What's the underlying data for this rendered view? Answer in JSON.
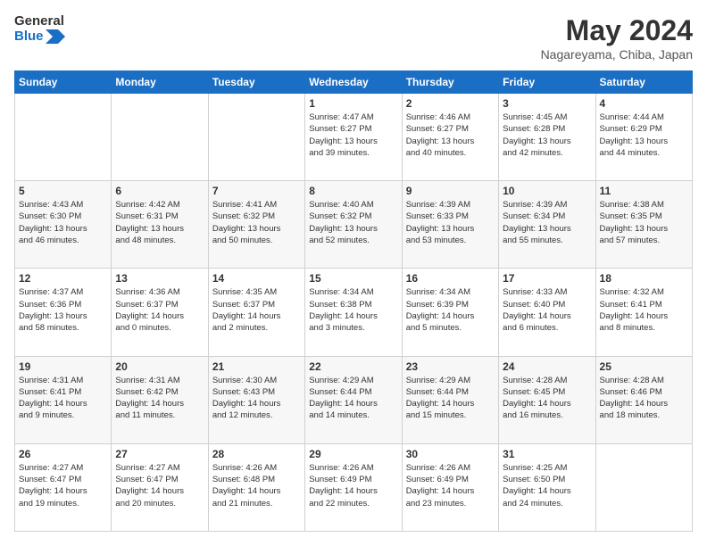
{
  "header": {
    "logo_line1": "General",
    "logo_line2": "Blue",
    "month_title": "May 2024",
    "location": "Nagareyama, Chiba, Japan"
  },
  "weekdays": [
    "Sunday",
    "Monday",
    "Tuesday",
    "Wednesday",
    "Thursday",
    "Friday",
    "Saturday"
  ],
  "weeks": [
    [
      {
        "day": "",
        "info": ""
      },
      {
        "day": "",
        "info": ""
      },
      {
        "day": "",
        "info": ""
      },
      {
        "day": "1",
        "info": "Sunrise: 4:47 AM\nSunset: 6:27 PM\nDaylight: 13 hours\nand 39 minutes."
      },
      {
        "day": "2",
        "info": "Sunrise: 4:46 AM\nSunset: 6:27 PM\nDaylight: 13 hours\nand 40 minutes."
      },
      {
        "day": "3",
        "info": "Sunrise: 4:45 AM\nSunset: 6:28 PM\nDaylight: 13 hours\nand 42 minutes."
      },
      {
        "day": "4",
        "info": "Sunrise: 4:44 AM\nSunset: 6:29 PM\nDaylight: 13 hours\nand 44 minutes."
      }
    ],
    [
      {
        "day": "5",
        "info": "Sunrise: 4:43 AM\nSunset: 6:30 PM\nDaylight: 13 hours\nand 46 minutes."
      },
      {
        "day": "6",
        "info": "Sunrise: 4:42 AM\nSunset: 6:31 PM\nDaylight: 13 hours\nand 48 minutes."
      },
      {
        "day": "7",
        "info": "Sunrise: 4:41 AM\nSunset: 6:32 PM\nDaylight: 13 hours\nand 50 minutes."
      },
      {
        "day": "8",
        "info": "Sunrise: 4:40 AM\nSunset: 6:32 PM\nDaylight: 13 hours\nand 52 minutes."
      },
      {
        "day": "9",
        "info": "Sunrise: 4:39 AM\nSunset: 6:33 PM\nDaylight: 13 hours\nand 53 minutes."
      },
      {
        "day": "10",
        "info": "Sunrise: 4:39 AM\nSunset: 6:34 PM\nDaylight: 13 hours\nand 55 minutes."
      },
      {
        "day": "11",
        "info": "Sunrise: 4:38 AM\nSunset: 6:35 PM\nDaylight: 13 hours\nand 57 minutes."
      }
    ],
    [
      {
        "day": "12",
        "info": "Sunrise: 4:37 AM\nSunset: 6:36 PM\nDaylight: 13 hours\nand 58 minutes."
      },
      {
        "day": "13",
        "info": "Sunrise: 4:36 AM\nSunset: 6:37 PM\nDaylight: 14 hours\nand 0 minutes."
      },
      {
        "day": "14",
        "info": "Sunrise: 4:35 AM\nSunset: 6:37 PM\nDaylight: 14 hours\nand 2 minutes."
      },
      {
        "day": "15",
        "info": "Sunrise: 4:34 AM\nSunset: 6:38 PM\nDaylight: 14 hours\nand 3 minutes."
      },
      {
        "day": "16",
        "info": "Sunrise: 4:34 AM\nSunset: 6:39 PM\nDaylight: 14 hours\nand 5 minutes."
      },
      {
        "day": "17",
        "info": "Sunrise: 4:33 AM\nSunset: 6:40 PM\nDaylight: 14 hours\nand 6 minutes."
      },
      {
        "day": "18",
        "info": "Sunrise: 4:32 AM\nSunset: 6:41 PM\nDaylight: 14 hours\nand 8 minutes."
      }
    ],
    [
      {
        "day": "19",
        "info": "Sunrise: 4:31 AM\nSunset: 6:41 PM\nDaylight: 14 hours\nand 9 minutes."
      },
      {
        "day": "20",
        "info": "Sunrise: 4:31 AM\nSunset: 6:42 PM\nDaylight: 14 hours\nand 11 minutes."
      },
      {
        "day": "21",
        "info": "Sunrise: 4:30 AM\nSunset: 6:43 PM\nDaylight: 14 hours\nand 12 minutes."
      },
      {
        "day": "22",
        "info": "Sunrise: 4:29 AM\nSunset: 6:44 PM\nDaylight: 14 hours\nand 14 minutes."
      },
      {
        "day": "23",
        "info": "Sunrise: 4:29 AM\nSunset: 6:44 PM\nDaylight: 14 hours\nand 15 minutes."
      },
      {
        "day": "24",
        "info": "Sunrise: 4:28 AM\nSunset: 6:45 PM\nDaylight: 14 hours\nand 16 minutes."
      },
      {
        "day": "25",
        "info": "Sunrise: 4:28 AM\nSunset: 6:46 PM\nDaylight: 14 hours\nand 18 minutes."
      }
    ],
    [
      {
        "day": "26",
        "info": "Sunrise: 4:27 AM\nSunset: 6:47 PM\nDaylight: 14 hours\nand 19 minutes."
      },
      {
        "day": "27",
        "info": "Sunrise: 4:27 AM\nSunset: 6:47 PM\nDaylight: 14 hours\nand 20 minutes."
      },
      {
        "day": "28",
        "info": "Sunrise: 4:26 AM\nSunset: 6:48 PM\nDaylight: 14 hours\nand 21 minutes."
      },
      {
        "day": "29",
        "info": "Sunrise: 4:26 AM\nSunset: 6:49 PM\nDaylight: 14 hours\nand 22 minutes."
      },
      {
        "day": "30",
        "info": "Sunrise: 4:26 AM\nSunset: 6:49 PM\nDaylight: 14 hours\nand 23 minutes."
      },
      {
        "day": "31",
        "info": "Sunrise: 4:25 AM\nSunset: 6:50 PM\nDaylight: 14 hours\nand 24 minutes."
      },
      {
        "day": "",
        "info": ""
      }
    ]
  ]
}
